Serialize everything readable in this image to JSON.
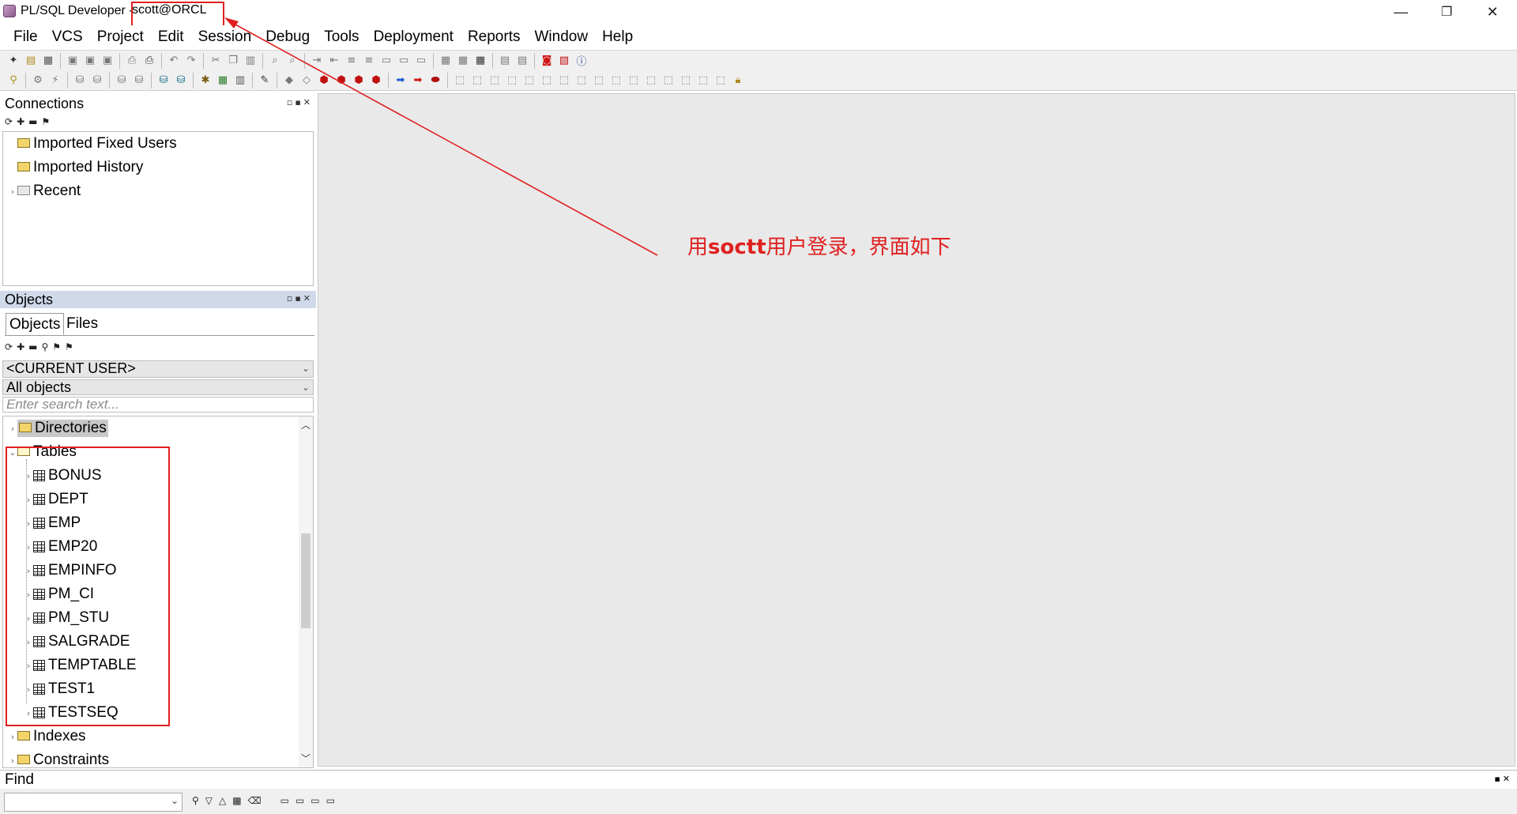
{
  "window": {
    "app_title": "PL/SQL Developer - ",
    "connection": "scott@ORCL",
    "minimize": "—",
    "restore": "❐",
    "close": "✕"
  },
  "menu": [
    "File",
    "VCS",
    "Project",
    "Edit",
    "Session",
    "Debug",
    "Tools",
    "Deployment",
    "Reports",
    "Window",
    "Help"
  ],
  "connections_panel": {
    "title": "Connections",
    "items": [
      "Imported Fixed Users",
      "Imported History",
      "Recent"
    ]
  },
  "objects_panel": {
    "title": "Objects",
    "tabs": [
      "Objects",
      "Files"
    ],
    "user_select": "<CURRENT USER>",
    "filter_select": "All objects",
    "search_placeholder": "Enter search text...",
    "tree": {
      "directories": "Directories",
      "tables": "Tables",
      "table_items": [
        "BONUS",
        "DEPT",
        "EMP",
        "EMP20",
        "EMPINFO",
        "PM_CI",
        "PM_STU",
        "SALGRADE",
        "TEMPTABLE",
        "TEST1",
        "TESTSEQ"
      ],
      "indexes": "Indexes",
      "constraints": "Constraints"
    }
  },
  "annotation": {
    "prefix": "用",
    "bold": "soctt",
    "suffix": "用户登录，界面如下",
    "color": "#e02020"
  },
  "find": {
    "title": "Find"
  },
  "colors": {
    "accent_red": "#e02020",
    "panel_header_selected": "#cfd9ea",
    "main_background": "#e9e9e9"
  }
}
